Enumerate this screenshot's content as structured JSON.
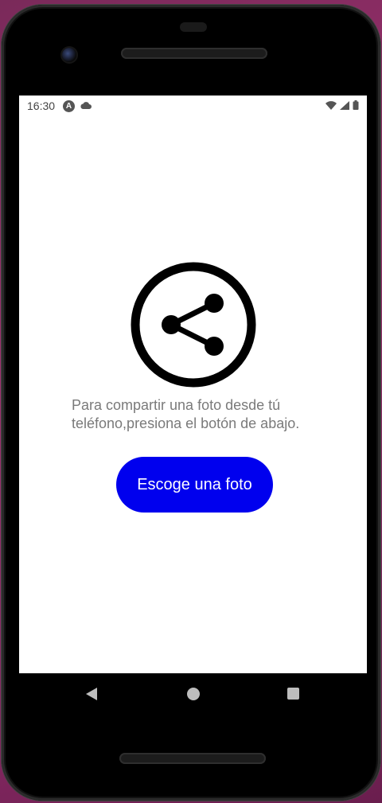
{
  "status_bar": {
    "time": "16:30",
    "left_icons": [
      "a-badge-icon",
      "cloud-icon"
    ],
    "right_icons": [
      "wifi-icon",
      "signal-icon",
      "battery-icon"
    ]
  },
  "main": {
    "icon": "share-icon",
    "message": "Para compartir una foto desde tú teléfono,presiona el botón de abajo.",
    "button_label": "Escoge una foto",
    "button_color": "#0000ee"
  },
  "navigation": {
    "icons": [
      "back-icon",
      "home-icon",
      "recents-icon"
    ]
  }
}
